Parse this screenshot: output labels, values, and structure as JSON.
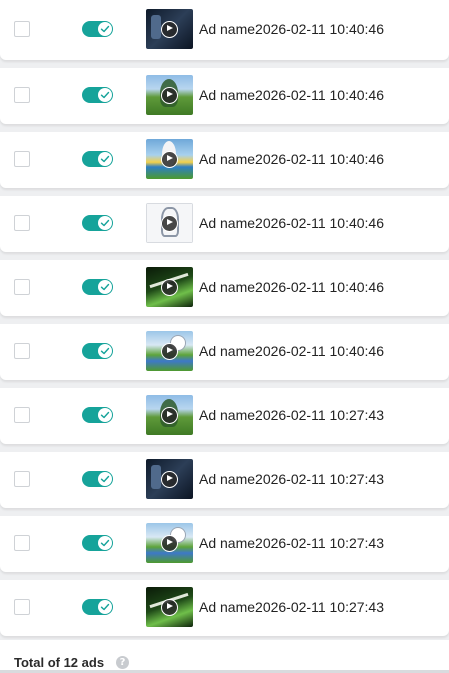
{
  "ads": [
    {
      "name": "Ad name2026-02-11 10:40:46",
      "enabled": true,
      "thumbnail": "dark-scene-video"
    },
    {
      "name": "Ad name2026-02-11 10:40:46",
      "enabled": true,
      "thumbnail": "field-scene-video"
    },
    {
      "name": "Ad name2026-02-11 10:40:46",
      "enabled": true,
      "thumbnail": "sky-scene-video"
    },
    {
      "name": "Ad name2026-02-11 10:40:46",
      "enabled": true,
      "thumbnail": "white-scene-video"
    },
    {
      "name": "Ad name2026-02-11 10:40:46",
      "enabled": true,
      "thumbnail": "green-scene-video"
    },
    {
      "name": "Ad name2026-02-11 10:40:46",
      "enabled": true,
      "thumbnail": "mixed-scene-video"
    },
    {
      "name": "Ad name2026-02-11 10:27:43",
      "enabled": true,
      "thumbnail": "field-scene-video"
    },
    {
      "name": "Ad name2026-02-11 10:27:43",
      "enabled": true,
      "thumbnail": "dark-scene-video"
    },
    {
      "name": "Ad name2026-02-11 10:27:43",
      "enabled": true,
      "thumbnail": "mixed-scene-video"
    },
    {
      "name": "Ad name2026-02-11 10:27:43",
      "enabled": true,
      "thumbnail": "green-scene-video"
    }
  ],
  "footer": {
    "total_label": "Total of 12 ads",
    "help_icon": "question-circle-icon"
  },
  "colors": {
    "toggle_on": "#16a39a",
    "row_background": "#ffffff",
    "page_background": "#eeeff1"
  }
}
